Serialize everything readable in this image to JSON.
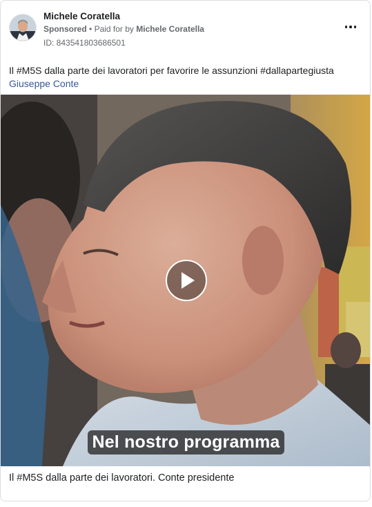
{
  "post": {
    "author_name": "Michele Coratella",
    "sponsored_label": "Sponsored",
    "separator": "•",
    "paid_for_prefix": "Paid for by",
    "paid_for_by": "Michele Coratella",
    "ad_id_label": "ID: 843541803686501",
    "text": "Il #M5S dalla parte dei lavoratori per favorire le assunzioni #dallapartegiusta",
    "tagged_link": "Giuseppe Conte",
    "video": {
      "caption": "Nel nostro programma",
      "play_icon": "play-icon"
    },
    "footer_text": "Il #M5S dalla parte dei lavoratori. Conte presidente"
  },
  "icons": {
    "more": "more-options-icon"
  },
  "colors": {
    "link": "#385898",
    "secondary_text": "#65676b",
    "border": "#dadde1"
  }
}
